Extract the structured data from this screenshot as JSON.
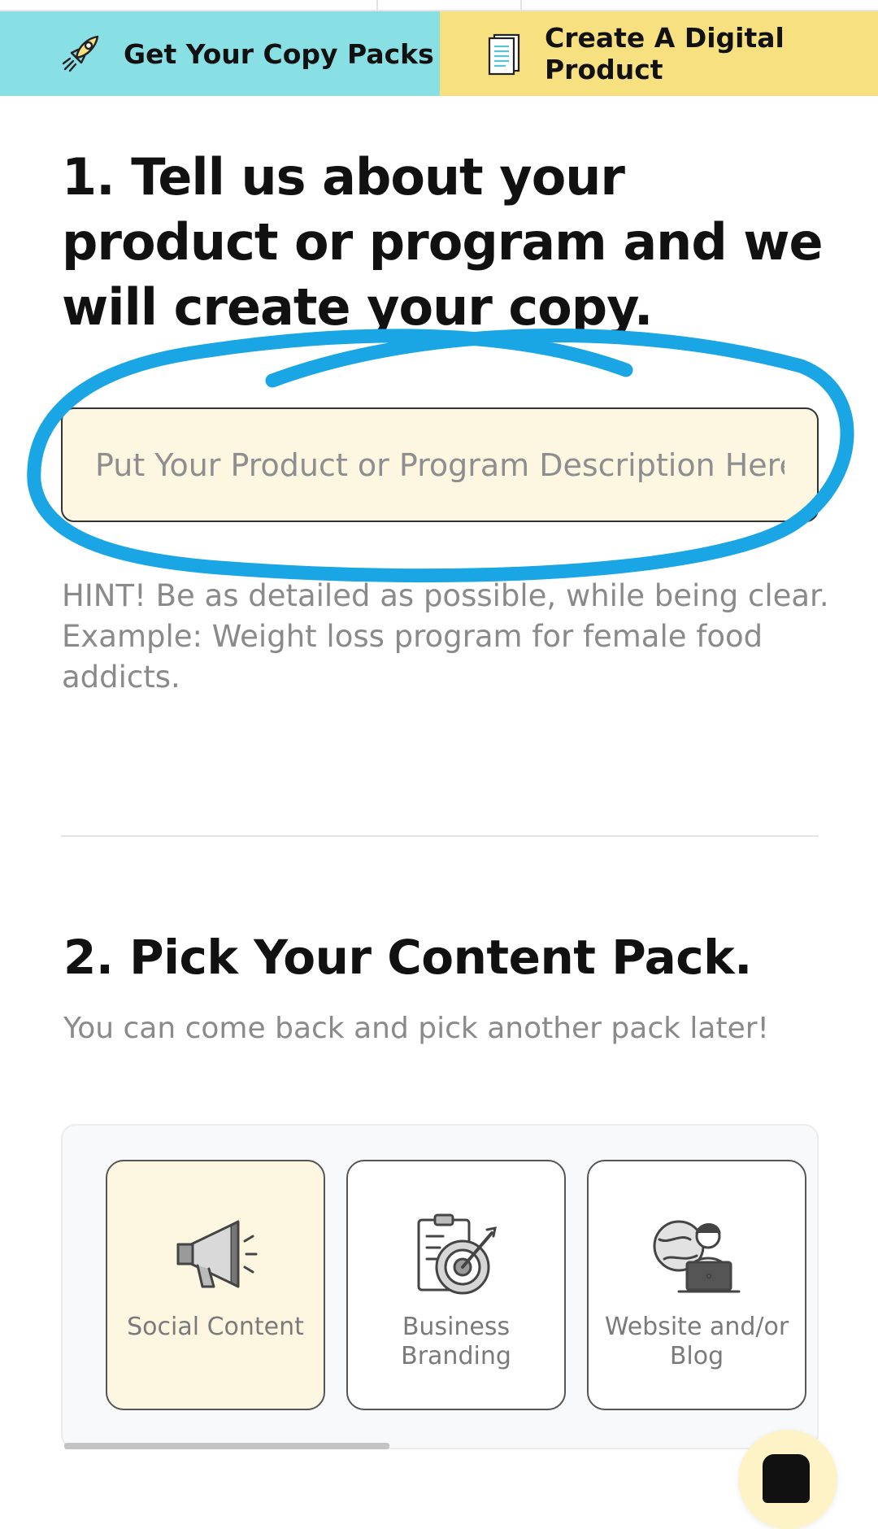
{
  "tabs": [
    {
      "label": "Get Your Copy Packs",
      "icon": "rocket-icon",
      "color": "#88dfe4"
    },
    {
      "label": "Create A Digital Product",
      "icon": "document-icon",
      "color": "#f7e07f"
    }
  ],
  "step1": {
    "heading": "1. Tell us about your product or program and we will create your copy.",
    "input_placeholder": "Put Your Product or Program Description Here",
    "input_value": "",
    "hint": "HINT! Be as detailed as possible, while being clear. Example: Weight loss program for female food addicts."
  },
  "step2": {
    "heading": "2. Pick Your Content Pack.",
    "subtitle": "You can come back and pick another pack later!",
    "packs": [
      {
        "label": "Social Content",
        "icon": "megaphone-icon",
        "selected": true
      },
      {
        "label": "Business Branding",
        "icon": "target-clipboard-icon",
        "selected": false
      },
      {
        "label": "Website and/or Blog",
        "icon": "person-laptop-globe-icon",
        "selected": false
      }
    ]
  },
  "colors": {
    "accent_cyan": "#88dfe4",
    "accent_yellow": "#f7e07f",
    "input_bg": "#fdf7e2",
    "scribble_blue": "#1aa6e4"
  }
}
